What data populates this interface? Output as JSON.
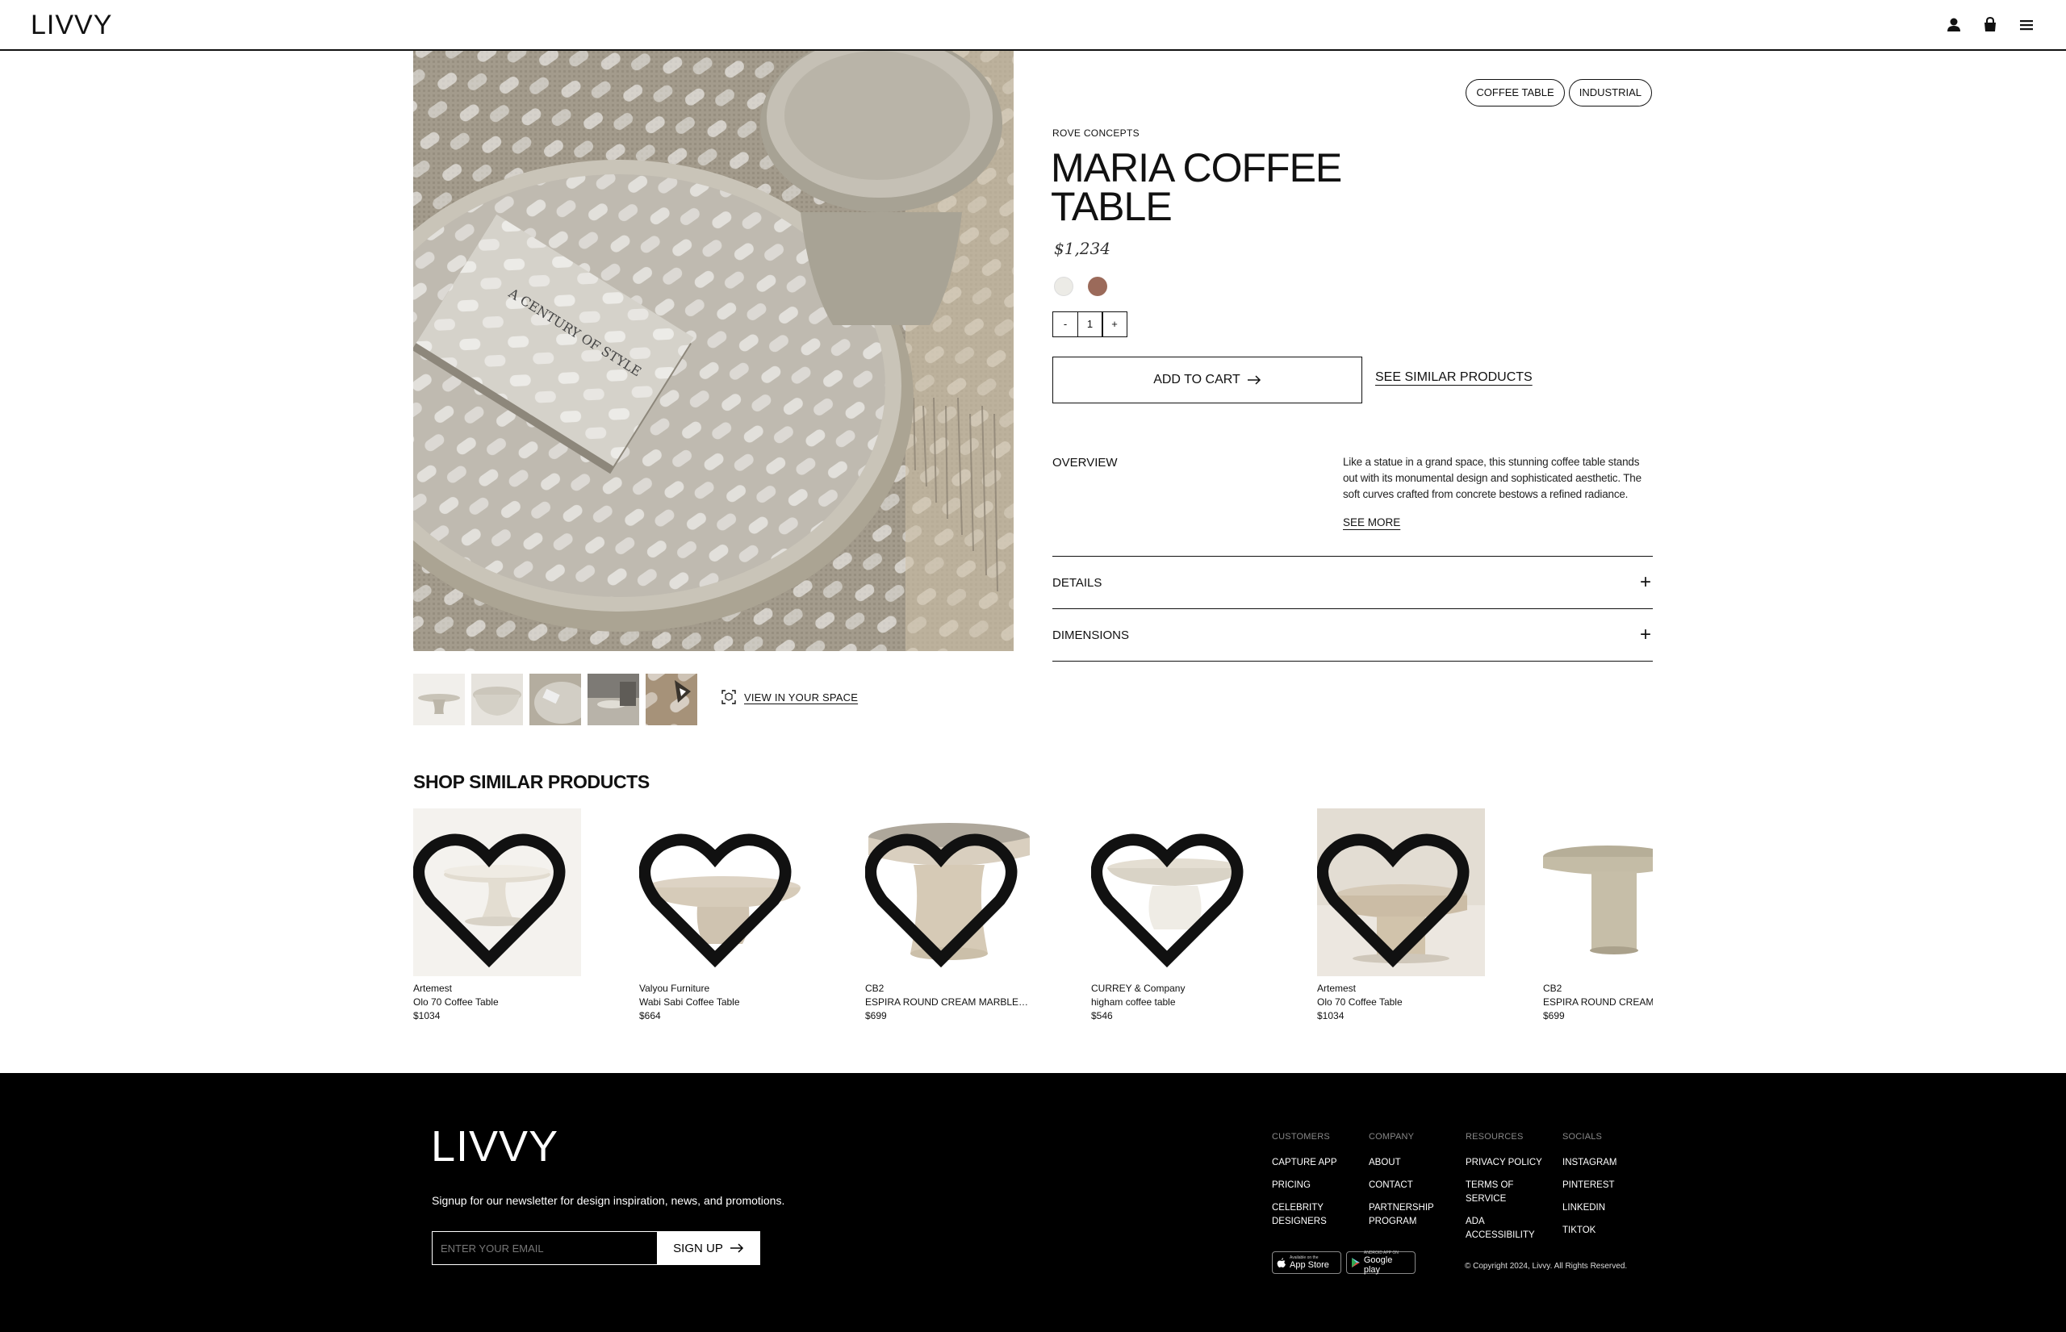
{
  "header": {
    "logo": "LIVVY"
  },
  "product": {
    "tags": [
      "COFFEE TABLE",
      "INDUSTRIAL"
    ],
    "brand": "ROVE CONCEPTS",
    "title": "MARIA COFFEE TABLE",
    "price": "$1,234",
    "swatches": [
      "#ecebe6",
      "#9b6a5a"
    ],
    "quantity": {
      "decrement": "-",
      "value": "1",
      "increment": "+"
    },
    "add_to_cart": "ADD TO CART",
    "see_similar": "SEE SIMILAR PRODUCTS",
    "overview_label": "OVERVIEW",
    "overview_text": "Like a statue in a grand space, this stunning coffee table stands out with its monumental design and sophisticated aesthetic. The soft curves crafted from concrete bestows a refined radiance.",
    "see_more": "SEE MORE",
    "accordions": [
      "DETAILS",
      "DIMENSIONS"
    ],
    "book_title": "A CENTURY OF STYLE"
  },
  "gallery": {
    "view_in_space": "VIEW IN YOUR SPACE"
  },
  "similar": {
    "title": "SHOP SIMILAR PRODUCTS",
    "items": [
      {
        "brand": "Artemest",
        "name": "Olo 70 Coffee Table",
        "price": "$1034"
      },
      {
        "brand": "Valyou Furniture",
        "name": "Wabi Sabi Coffee Table",
        "price": "$664"
      },
      {
        "brand": "CB2",
        "name": "ESPIRA ROUND CREAM MARBLED R...",
        "price": "$699"
      },
      {
        "brand": "CURREY & Company",
        "name": "higham coffee table",
        "price": "$546"
      },
      {
        "brand": "Artemest",
        "name": "Olo 70 Coffee Table",
        "price": "$1034"
      },
      {
        "brand": "CB2",
        "name": "ESPIRA ROUND CREAM MARBLED R...",
        "price": "$699"
      }
    ]
  },
  "footer": {
    "logo": "LIVVY",
    "newsletter": "Signup for our newsletter for design inspiration, news, and promotions.",
    "email_placeholder": "ENTER YOUR EMAIL",
    "signup": "SIGN UP",
    "columns": [
      {
        "heading": "CUSTOMERS",
        "links": [
          "CAPTURE APP",
          "PRICING",
          "CELEBRITY DESIGNERS"
        ]
      },
      {
        "heading": "COMPANY",
        "links": [
          "ABOUT",
          "CONTACT",
          "PARTNERSHIP PROGRAM"
        ]
      },
      {
        "heading": "RESOURCES",
        "links": [
          "PRIVACY POLICY",
          "TERMS OF SERVICE",
          "ADA ACCESSIBILITY"
        ]
      },
      {
        "heading": "SOCIALS",
        "links": [
          "INSTAGRAM",
          "PINTEREST",
          "LINKEDIN",
          "TIKTOK"
        ]
      }
    ],
    "app_store": {
      "small": "Available on the",
      "big": "App Store"
    },
    "google_play": {
      "small": "ANDROID APP ON",
      "big": "Google play"
    },
    "copyright": "© Copyright 2024, Livvy. All Rights Reserved."
  }
}
